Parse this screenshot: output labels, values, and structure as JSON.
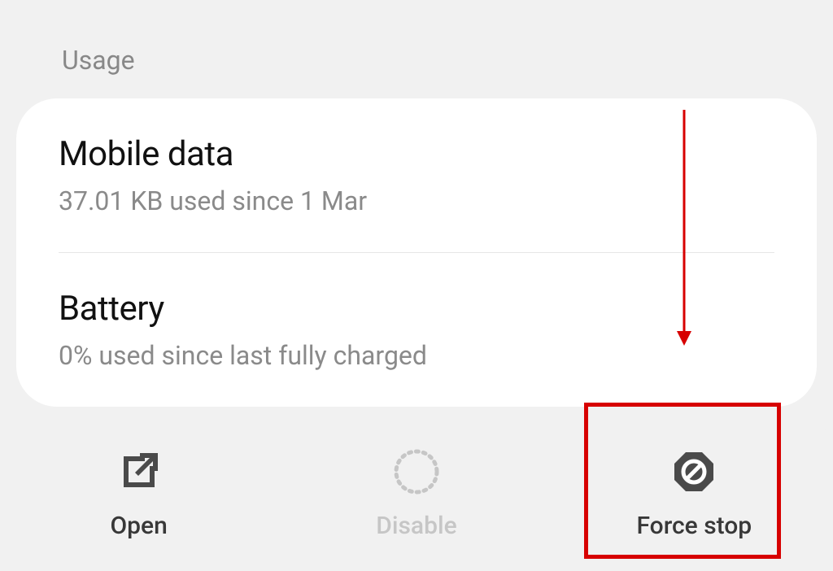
{
  "section": {
    "header": "Usage"
  },
  "usage": {
    "mobile_data": {
      "title": "Mobile data",
      "subtitle": "37.01 KB used since 1 Mar"
    },
    "battery": {
      "title": "Battery",
      "subtitle": "0% used since last fully charged"
    }
  },
  "actions": {
    "open": {
      "label": "Open"
    },
    "disable": {
      "label": "Disable"
    },
    "force_stop": {
      "label": "Force stop"
    }
  }
}
